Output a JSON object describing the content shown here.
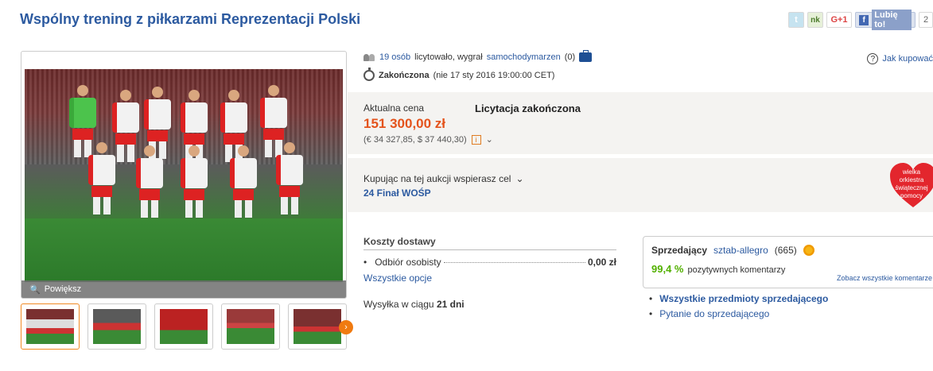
{
  "title": "Wspólny trening z piłkarzami Reprezentacji Polski",
  "social": {
    "gplus": "G+1",
    "fb_like": "Lubię to!",
    "fb_count": "2",
    "nk": "nk"
  },
  "gallery": {
    "zoom_label": "Powiększ"
  },
  "auction": {
    "bidders_link": "19 osób",
    "bidders_text": "licytowało, wygrał",
    "winner": "samochodymarzen",
    "winner_score": "(0)",
    "ended_label": "Zakończona",
    "ended_date": "(nie 17 sty 2016 19:00:00 CET)",
    "help": "Jak kupować"
  },
  "price": {
    "label": "Aktualna cena",
    "value": "151 300,00 zł",
    "converted": "(€ 34 327,85, $ 37 440,30)",
    "status": "Licytacja zakończona"
  },
  "charity": {
    "label": "Kupując na tej aukcji wspierasz cel",
    "name": "24 Finał WOŚP",
    "logo_text": "wielka orkiestra świątecznej pomocy"
  },
  "shipping": {
    "title": "Koszty dostawy",
    "rows": [
      {
        "method": "Odbiór osobisty",
        "cost": "0,00 zł"
      }
    ],
    "all_options": "Wszystkie opcje",
    "dispatch_prefix": "Wysyłka w ciągu",
    "dispatch_value": "21 dni"
  },
  "seller": {
    "label": "Sprzedający",
    "name": "sztab-allegro",
    "score": "(665)",
    "positive_pct": "99,4 %",
    "positive_text": "pozytywnych komentarzy",
    "comments_link": "Zobacz wszystkie komentarze",
    "links": [
      "Wszystkie przedmioty sprzedającego",
      "Pytanie do sprzedającego"
    ]
  }
}
